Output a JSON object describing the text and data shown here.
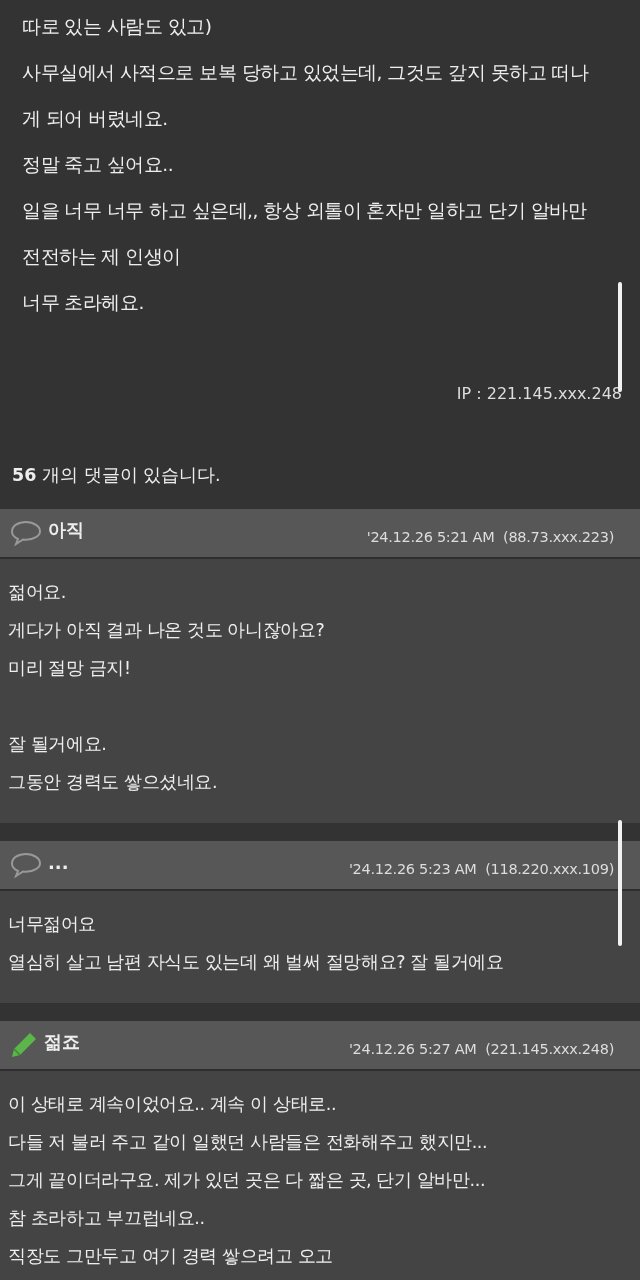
{
  "post": {
    "lines": [
      "따로 있는 사람도 있고)",
      "사무실에서 사적으로 보복 당하고 있었는데, 그것도 갚지 못하고 떠나",
      "게 되어 버렸네요.",
      "정말 죽고 싶어요..",
      "일을 너무 너무 하고 싶은데,, 항상 외톨이 혼자만 일하고 단기 알바만",
      "전전하는 제 인생이",
      "너무 초라헤요."
    ],
    "ip": "IP : 221.145.xxx.248"
  },
  "comment_count": {
    "number": "56",
    "text": "개의 댓글이 있습니다."
  },
  "comments": [
    {
      "kind": "speech",
      "author": "아직",
      "date": "'24.12.26 5:21 AM",
      "ip": "(88.73.xxx.223)",
      "paragraphs": [
        [
          "젊어요.",
          "게다가 아직 결과 나온 것도 아니잖아요?",
          "미리 절망 금지!"
        ],
        [
          "잘 될거에요.",
          "그동안 경력도 쌓으셨네요."
        ]
      ]
    },
    {
      "kind": "speech",
      "author": "...",
      "date": "'24.12.26 5:23 AM",
      "ip": "(118.220.xxx.109)",
      "paragraphs": [
        [
          "너무젊어요",
          "열심히 살고 남편 자식도 있는데 왜 벌써 절망해요? 잘 될거에요"
        ]
      ]
    },
    {
      "kind": "pencil",
      "author": "젊죠",
      "date": "'24.12.26 5:27 AM",
      "ip": "(221.145.xxx.248)",
      "paragraphs": [
        [
          "이 상태로 계속이었어요.. 계속 이 상태로..",
          "다들 저 불러 주고 같이 일했던 사람들은 전화해주고 했지만...",
          "그게 끝이더라구요. 제가 있던 곳은 다 짧은 곳, 단기 알바만...",
          "참 초라하고 부끄럽네요..",
          "직장도 그만두고 여기 경력 쌓으려고 오고"
        ]
      ]
    }
  ]
}
